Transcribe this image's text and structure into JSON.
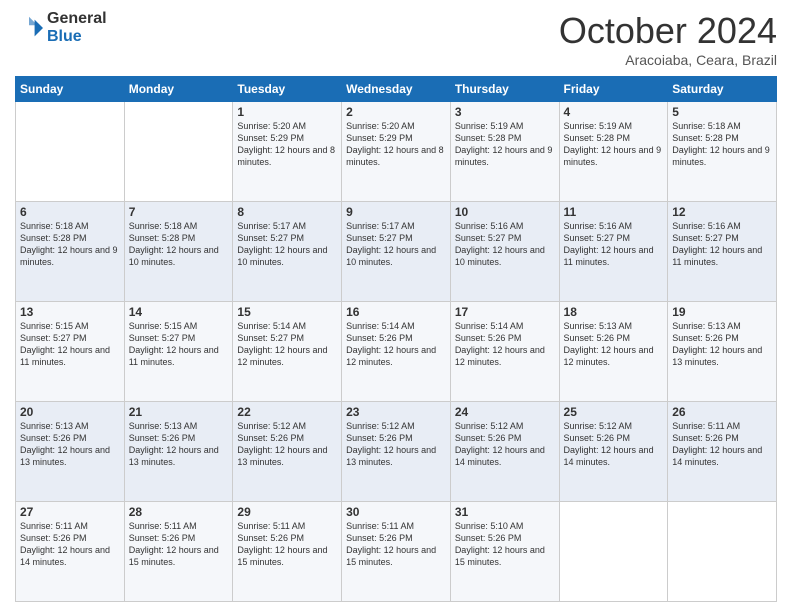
{
  "logo": {
    "general": "General",
    "blue": "Blue"
  },
  "header": {
    "month": "October 2024",
    "location": "Aracoiaba, Ceara, Brazil"
  },
  "days_of_week": [
    "Sunday",
    "Monday",
    "Tuesday",
    "Wednesday",
    "Thursday",
    "Friday",
    "Saturday"
  ],
  "weeks": [
    [
      {
        "day": "",
        "text": ""
      },
      {
        "day": "",
        "text": ""
      },
      {
        "day": "1",
        "text": "Sunrise: 5:20 AM\nSunset: 5:29 PM\nDaylight: 12 hours and 8 minutes."
      },
      {
        "day": "2",
        "text": "Sunrise: 5:20 AM\nSunset: 5:29 PM\nDaylight: 12 hours and 8 minutes."
      },
      {
        "day": "3",
        "text": "Sunrise: 5:19 AM\nSunset: 5:28 PM\nDaylight: 12 hours and 9 minutes."
      },
      {
        "day": "4",
        "text": "Sunrise: 5:19 AM\nSunset: 5:28 PM\nDaylight: 12 hours and 9 minutes."
      },
      {
        "day": "5",
        "text": "Sunrise: 5:18 AM\nSunset: 5:28 PM\nDaylight: 12 hours and 9 minutes."
      }
    ],
    [
      {
        "day": "6",
        "text": "Sunrise: 5:18 AM\nSunset: 5:28 PM\nDaylight: 12 hours and 9 minutes."
      },
      {
        "day": "7",
        "text": "Sunrise: 5:18 AM\nSunset: 5:28 PM\nDaylight: 12 hours and 10 minutes."
      },
      {
        "day": "8",
        "text": "Sunrise: 5:17 AM\nSunset: 5:27 PM\nDaylight: 12 hours and 10 minutes."
      },
      {
        "day": "9",
        "text": "Sunrise: 5:17 AM\nSunset: 5:27 PM\nDaylight: 12 hours and 10 minutes."
      },
      {
        "day": "10",
        "text": "Sunrise: 5:16 AM\nSunset: 5:27 PM\nDaylight: 12 hours and 10 minutes."
      },
      {
        "day": "11",
        "text": "Sunrise: 5:16 AM\nSunset: 5:27 PM\nDaylight: 12 hours and 11 minutes."
      },
      {
        "day": "12",
        "text": "Sunrise: 5:16 AM\nSunset: 5:27 PM\nDaylight: 12 hours and 11 minutes."
      }
    ],
    [
      {
        "day": "13",
        "text": "Sunrise: 5:15 AM\nSunset: 5:27 PM\nDaylight: 12 hours and 11 minutes."
      },
      {
        "day": "14",
        "text": "Sunrise: 5:15 AM\nSunset: 5:27 PM\nDaylight: 12 hours and 11 minutes."
      },
      {
        "day": "15",
        "text": "Sunrise: 5:14 AM\nSunset: 5:27 PM\nDaylight: 12 hours and 12 minutes."
      },
      {
        "day": "16",
        "text": "Sunrise: 5:14 AM\nSunset: 5:26 PM\nDaylight: 12 hours and 12 minutes."
      },
      {
        "day": "17",
        "text": "Sunrise: 5:14 AM\nSunset: 5:26 PM\nDaylight: 12 hours and 12 minutes."
      },
      {
        "day": "18",
        "text": "Sunrise: 5:13 AM\nSunset: 5:26 PM\nDaylight: 12 hours and 12 minutes."
      },
      {
        "day": "19",
        "text": "Sunrise: 5:13 AM\nSunset: 5:26 PM\nDaylight: 12 hours and 13 minutes."
      }
    ],
    [
      {
        "day": "20",
        "text": "Sunrise: 5:13 AM\nSunset: 5:26 PM\nDaylight: 12 hours and 13 minutes."
      },
      {
        "day": "21",
        "text": "Sunrise: 5:13 AM\nSunset: 5:26 PM\nDaylight: 12 hours and 13 minutes."
      },
      {
        "day": "22",
        "text": "Sunrise: 5:12 AM\nSunset: 5:26 PM\nDaylight: 12 hours and 13 minutes."
      },
      {
        "day": "23",
        "text": "Sunrise: 5:12 AM\nSunset: 5:26 PM\nDaylight: 12 hours and 13 minutes."
      },
      {
        "day": "24",
        "text": "Sunrise: 5:12 AM\nSunset: 5:26 PM\nDaylight: 12 hours and 14 minutes."
      },
      {
        "day": "25",
        "text": "Sunrise: 5:12 AM\nSunset: 5:26 PM\nDaylight: 12 hours and 14 minutes."
      },
      {
        "day": "26",
        "text": "Sunrise: 5:11 AM\nSunset: 5:26 PM\nDaylight: 12 hours and 14 minutes."
      }
    ],
    [
      {
        "day": "27",
        "text": "Sunrise: 5:11 AM\nSunset: 5:26 PM\nDaylight: 12 hours and 14 minutes."
      },
      {
        "day": "28",
        "text": "Sunrise: 5:11 AM\nSunset: 5:26 PM\nDaylight: 12 hours and 15 minutes."
      },
      {
        "day": "29",
        "text": "Sunrise: 5:11 AM\nSunset: 5:26 PM\nDaylight: 12 hours and 15 minutes."
      },
      {
        "day": "30",
        "text": "Sunrise: 5:11 AM\nSunset: 5:26 PM\nDaylight: 12 hours and 15 minutes."
      },
      {
        "day": "31",
        "text": "Sunrise: 5:10 AM\nSunset: 5:26 PM\nDaylight: 12 hours and 15 minutes."
      },
      {
        "day": "",
        "text": ""
      },
      {
        "day": "",
        "text": ""
      }
    ]
  ]
}
